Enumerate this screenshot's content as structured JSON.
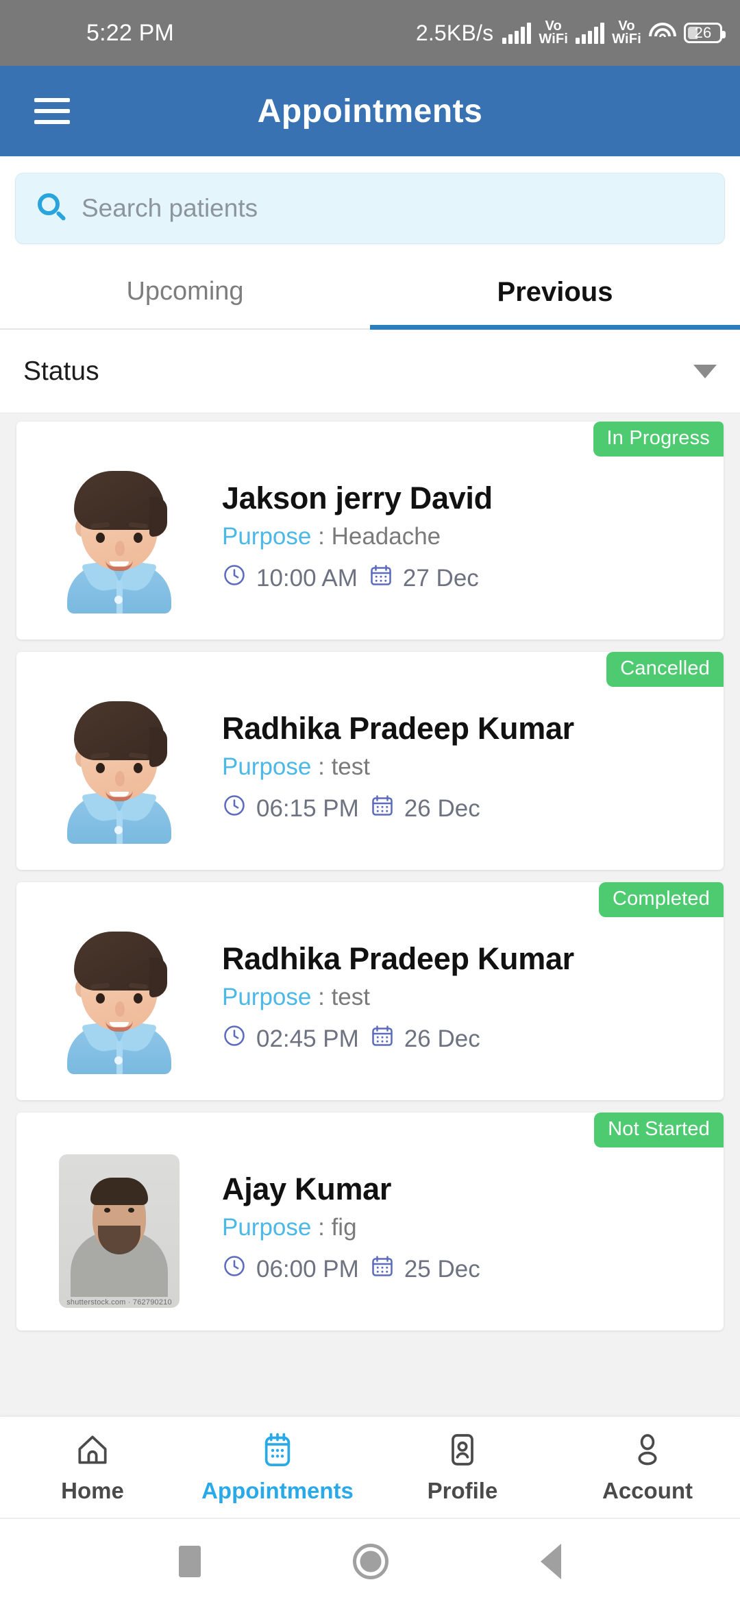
{
  "statusbar": {
    "time": "5:22 PM",
    "network_speed": "2.5KB/s",
    "volte_label_top": "Vo",
    "volte_label_bottom": "WiFi",
    "battery_percent": "26"
  },
  "appbar": {
    "title": "Appointments",
    "menu_icon": "hamburger-menu-icon"
  },
  "search": {
    "placeholder": "Search patients",
    "value": "",
    "icon": "search-icon"
  },
  "tabs": [
    {
      "label": "Upcoming",
      "active": false
    },
    {
      "label": "Previous",
      "active": true
    }
  ],
  "filter": {
    "label": "Status",
    "caret_icon": "chevron-down-icon"
  },
  "appointments": [
    {
      "name": "Jakson jerry David",
      "purpose_label": "Purpose",
      "purpose_separator": ":",
      "purpose_value": "Headache",
      "time": "10:00 AM",
      "date": "27 Dec",
      "status": "In Progress",
      "avatar_type": "cartoon"
    },
    {
      "name": "Radhika Pradeep Kumar",
      "purpose_label": "Purpose",
      "purpose_separator": ":",
      "purpose_value": "test",
      "time": "06:15 PM",
      "date": "26 Dec",
      "status": "Cancelled",
      "avatar_type": "cartoon"
    },
    {
      "name": "Radhika Pradeep Kumar",
      "purpose_label": "Purpose",
      "purpose_separator": ":",
      "purpose_value": "test",
      "time": "02:45 PM",
      "date": "26 Dec",
      "status": "Completed",
      "avatar_type": "cartoon"
    },
    {
      "name": "Ajay Kumar",
      "purpose_label": "Purpose",
      "purpose_separator": ":",
      "purpose_value": "fig",
      "time": "06:00 PM",
      "date": "25 Dec",
      "status": "Not Started",
      "avatar_type": "photo",
      "avatar_watermark": "shutterstock.com · 762790210"
    }
  ],
  "bottom_nav": [
    {
      "label": "Home",
      "icon": "home-icon",
      "active": false
    },
    {
      "label": "Appointments",
      "icon": "calendar-icon",
      "active": true
    },
    {
      "label": "Profile",
      "icon": "id-card-icon",
      "active": false
    },
    {
      "label": "Account",
      "icon": "person-icon",
      "active": false
    }
  ],
  "android_nav": [
    {
      "icon": "recents-square-icon"
    },
    {
      "icon": "home-circle-icon"
    },
    {
      "icon": "back-triangle-icon"
    }
  ],
  "colors": {
    "appbar_blue": "#3872b3",
    "accent_cyan": "#29a9e8",
    "badge_green": "#4ecb71",
    "purpose_blue": "#4cb8e8",
    "meta_indigo": "#5c6bc0",
    "tab_underline": "#2a7ec0",
    "page_bg": "#f2f2f2",
    "search_bg": "#e5f5fc"
  }
}
